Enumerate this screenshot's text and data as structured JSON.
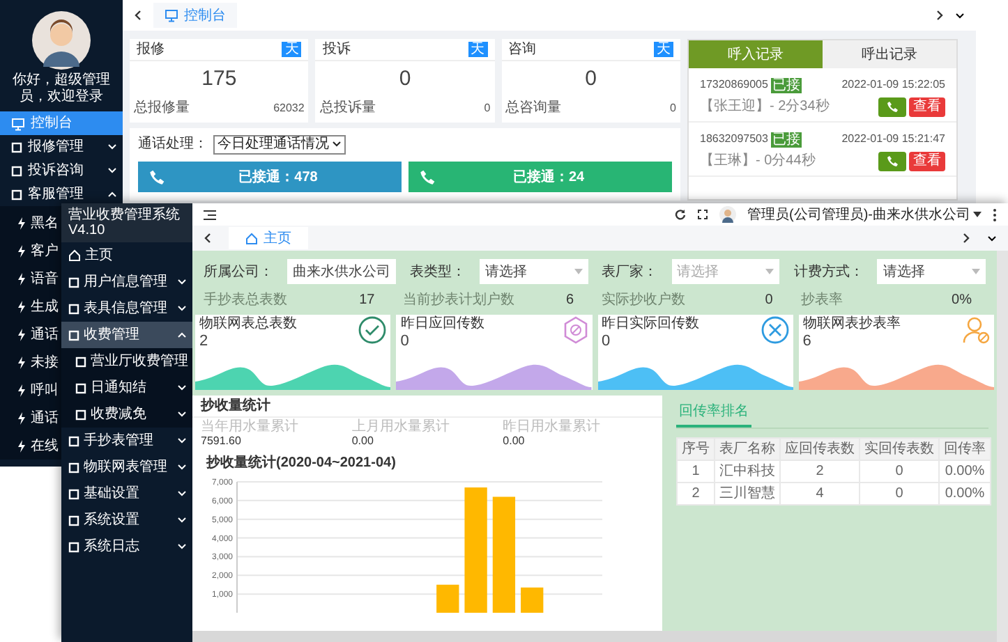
{
  "back_window": {
    "greeting": "你好，超级管理员，欢迎登录",
    "sidebar": [
      {
        "label": "控制台",
        "selected": true,
        "expanded": false
      },
      {
        "label": "报修管理",
        "selected": false,
        "expanded": false
      },
      {
        "label": "投诉咨询",
        "selected": false,
        "expanded": false
      },
      {
        "label": "客服管理",
        "selected": false,
        "expanded": true,
        "children": [
          {
            "label": "黑名"
          },
          {
            "label": "客户"
          },
          {
            "label": "语音"
          },
          {
            "label": "生成"
          },
          {
            "label": "通话"
          },
          {
            "label": "未接"
          },
          {
            "label": "呼叫"
          },
          {
            "label": "通话"
          },
          {
            "label": "在线"
          }
        ]
      }
    ],
    "tabs": [
      {
        "label": "控制台",
        "selected": true
      }
    ],
    "stat_cards": [
      {
        "title": "报修",
        "badge": "天",
        "value": "175",
        "total_label": "总报修量",
        "total": "62032"
      },
      {
        "title": "投诉",
        "badge": "天",
        "value": "0",
        "total_label": "总投诉量",
        "total": "0"
      },
      {
        "title": "咨询",
        "badge": "天",
        "value": "0",
        "total_label": "总咨询量",
        "total": "0"
      }
    ],
    "call_handling": {
      "label": "通话处理：",
      "value": "今日处理通话情况"
    },
    "call_bars": [
      {
        "label": "已接通：478",
        "color": "#2e95c3"
      },
      {
        "label": "已接通：24",
        "color": "#28b574"
      }
    ],
    "call_log": {
      "tabs": [
        {
          "label": "呼入记录",
          "selected": true
        },
        {
          "label": "呼出记录",
          "selected": false
        }
      ],
      "records": [
        {
          "number": "17320869005",
          "status": "已接",
          "time": "2022-01-09 15:22:05",
          "detail": "【张王迎】- 2分34秒",
          "action": "查看"
        },
        {
          "number": "18632097503",
          "status": "已接",
          "time": "2022-01-09 15:21:47",
          "detail": "【王琳】- 0分44秒",
          "action": "查看"
        }
      ]
    }
  },
  "front_window": {
    "app_title": "营业收费管理系统 V4.10",
    "sidebar": [
      {
        "label": "主页",
        "selected": false,
        "expandable": false
      },
      {
        "label": "用户信息管理",
        "selected": false,
        "expandable": true,
        "expanded": false
      },
      {
        "label": "表具信息管理",
        "selected": false,
        "expandable": true,
        "expanded": false
      },
      {
        "label": "收费管理",
        "selected": true,
        "expandable": true,
        "expanded": true,
        "children": [
          {
            "label": "营业厅收费管理"
          },
          {
            "label": "日通知结"
          },
          {
            "label": "收费减免"
          }
        ]
      },
      {
        "label": "手抄表管理",
        "selected": false,
        "expandable": true,
        "expanded": false
      },
      {
        "label": "物联网表管理",
        "selected": false,
        "expandable": true,
        "expanded": false
      },
      {
        "label": "基础设置",
        "selected": false,
        "expandable": true,
        "expanded": false
      },
      {
        "label": "系统设置",
        "selected": false,
        "expandable": true,
        "expanded": false
      },
      {
        "label": "系统日志",
        "selected": false,
        "expandable": true,
        "expanded": false
      }
    ],
    "user": "管理员(公司管理员)-曲来水供水公司",
    "tabs": [
      {
        "label": "主页",
        "selected": true
      }
    ],
    "filters": [
      {
        "kind": "input",
        "label": "所属公司：",
        "value": "曲来水供水公司"
      },
      {
        "kind": "select",
        "label": "表类型：",
        "value": "请选择"
      },
      {
        "kind": "select",
        "label": "表厂家：",
        "placeholder": "请选择"
      },
      {
        "kind": "select",
        "label": "计费方式：",
        "value": "请选择"
      }
    ],
    "stats": [
      {
        "label": "手抄表总表数",
        "value": "17"
      },
      {
        "label": "当前抄表计划户数",
        "value": "6"
      },
      {
        "label": "实际抄收户数",
        "value": "0"
      },
      {
        "label": "抄表率",
        "value": "0%"
      }
    ],
    "cards": [
      {
        "kind": "check",
        "title": "物联网表总表数",
        "value": "2",
        "color": "#4dd4b0"
      },
      {
        "kind": "hexagon",
        "title": "昨日应回传数",
        "value": "0",
        "color": "#c3a8ea"
      },
      {
        "kind": "cross",
        "title": "昨日实际回传数",
        "value": "0",
        "color": "#4dbff5"
      },
      {
        "kind": "user",
        "title": "物联网表抄表率",
        "value": "6",
        "color": "#f8a98c"
      }
    ],
    "usage": {
      "title": "抄收量统计",
      "totals": [
        {
          "label": "当年用水量累计",
          "value": "7591.60"
        },
        {
          "label": "上月用水量累计",
          "value": "0.00"
        },
        {
          "label": "昨日用水量累计",
          "value": "0.00"
        }
      ],
      "chart_data": {
        "type": "bar",
        "title": "抄收量统计(2020-04~2021-04)",
        "values": [
          null,
          null,
          null,
          null,
          null,
          null,
          null,
          1500,
          6700,
          6200,
          1350,
          null,
          null
        ],
        "grid": true,
        "ylim": [
          0,
          7000
        ],
        "yticks": [
          {
            "value": 1000,
            "label": "1,000"
          },
          {
            "value": 2000,
            "label": "2,000"
          },
          {
            "value": 3000,
            "label": "3,000"
          },
          {
            "value": 4000,
            "label": "4,000"
          },
          {
            "value": 5000,
            "label": "5,000"
          },
          {
            "value": 6000,
            "label": "6,000"
          },
          {
            "value": 7000,
            "label": "7,000"
          }
        ]
      }
    },
    "ranking": {
      "tabs": [
        {
          "label": "回传率排名",
          "selected": true
        }
      ],
      "columns": [
        "序号",
        "表厂名称",
        "应回传表数",
        "实回传表数",
        "回传率"
      ],
      "rows": [
        [
          "1",
          "汇中科技",
          "2",
          "0",
          "0.00%"
        ],
        [
          "2",
          "三川智慧",
          "4",
          "0",
          "0.00%"
        ]
      ]
    }
  }
}
